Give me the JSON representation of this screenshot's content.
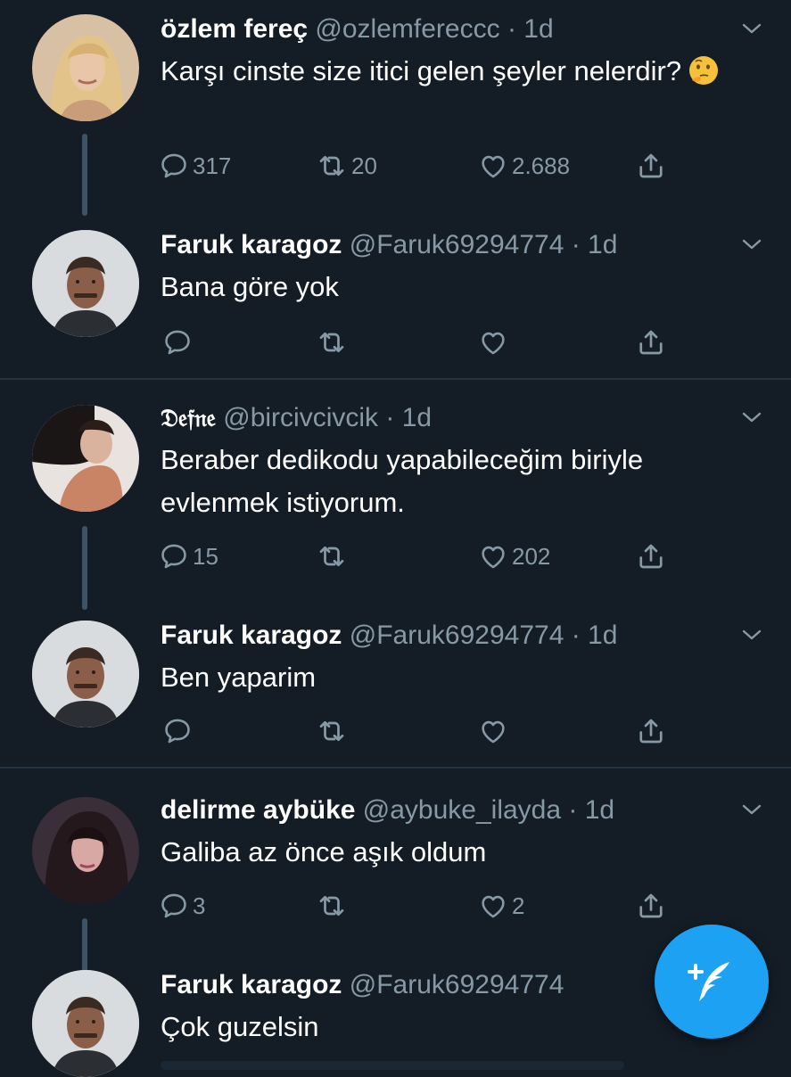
{
  "tweets": [
    {
      "name": "özlem fereç",
      "handle": "@ozlemfereccc",
      "time": "· 1d",
      "text": "Karşı cinste size itici gelen şeyler nelerdir?",
      "replies": "317",
      "retweets": "20",
      "likes": "2.688"
    },
    {
      "name": "Faruk karagoz",
      "handle": "@Faruk69294774",
      "time": "· 1d",
      "text": "Bana göre yok",
      "replies": "",
      "retweets": "",
      "likes": ""
    },
    {
      "name": "𝔇𝔢𝔣𝔫𝔢",
      "handle": "@bircivcivcik",
      "time": "· 1d",
      "text": "Beraber dedikodu yapabileceğim biriyle evlenmek istiyorum.",
      "replies": "15",
      "retweets": "",
      "likes": "202"
    },
    {
      "name": "Faruk karagoz",
      "handle": "@Faruk69294774",
      "time": "· 1d",
      "text": "Ben yaparim",
      "replies": "",
      "retweets": "",
      "likes": ""
    },
    {
      "name": "delirme aybüke",
      "handle": "@aybuke_ilayda",
      "time": "· 1d",
      "text": "Galiba az önce aşık oldum",
      "replies": "3",
      "retweets": "",
      "likes": "2"
    },
    {
      "name": "Faruk karagoz",
      "handle": "@Faruk69294774",
      "time": "",
      "text": "Çok guzelsin",
      "replies": "",
      "retweets": "",
      "likes": ""
    }
  ],
  "icons": {
    "reply": "reply-icon",
    "retweet": "retweet-icon",
    "like": "heart-icon",
    "share": "share-icon",
    "menu": "chevron-down-icon",
    "compose": "compose-tweet-icon",
    "emoji": "thinking-face-icon"
  },
  "colors": {
    "background": "#141d26",
    "secondary_text": "#8899a6",
    "accent": "#1da1f2",
    "thread_line": "#3d5466"
  }
}
